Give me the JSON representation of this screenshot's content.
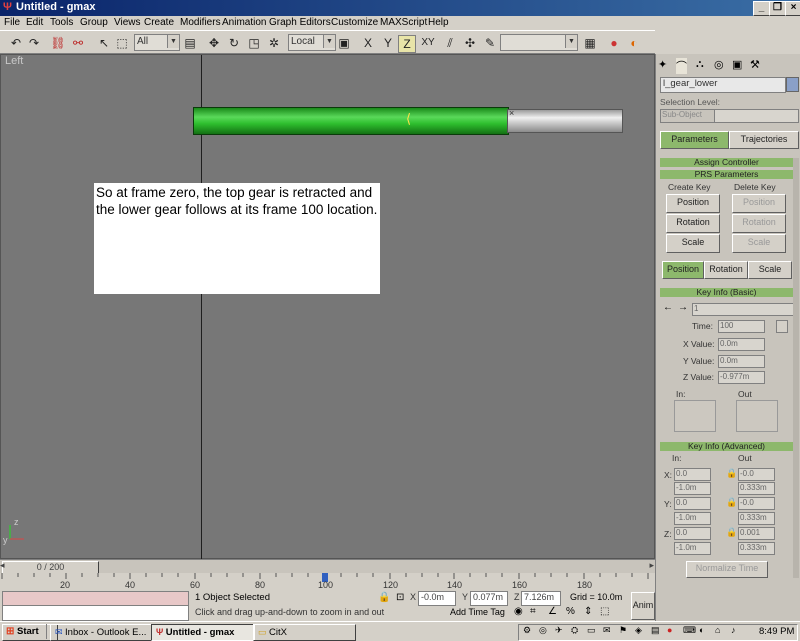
{
  "window": {
    "title": "Untitled - gmax",
    "min": "_",
    "max": "❐",
    "close": "×"
  },
  "menu": [
    "File",
    "Edit",
    "Tools",
    "Group",
    "Views",
    "Create",
    "Modifiers",
    "Animation",
    "Graph Editors",
    "Customize",
    "MAXScript",
    "Help"
  ],
  "toolbar": {
    "selection_filter": "All",
    "coord_system": "Local",
    "axis_z": "Z",
    "axis_xy": "XY",
    "axis_x": "X",
    "axis_y": "Y"
  },
  "viewport": {
    "label": "Left",
    "note": "So at frame zero, the top gear is retracted and the lower gear follows at its frame 100 location.",
    "axis_y": "y",
    "axis_z": "z"
  },
  "timeline": {
    "slider": "0 / 200",
    "ticks": [
      "20",
      "40",
      "60",
      "80",
      "100",
      "120",
      "140",
      "160",
      "180"
    ]
  },
  "status": {
    "selection": "1 Object Selected",
    "prompt": "Click and drag up-and-down to zoom in and out",
    "x_label": "X",
    "x_value": "-0.0m",
    "y_label": "Y",
    "y_value": "0.077m",
    "z_label": "Z",
    "z_value": "7.126m",
    "grid": "Grid = 10.0m",
    "add_time_tag": "Add Time Tag"
  },
  "playback": {
    "anim": "Anim",
    "frame": "0"
  },
  "panel": {
    "object_name": "l_gear_lower",
    "selection_level": "Selection Level:",
    "sub_object": "Sub-Object",
    "tab_parameters": "Parameters",
    "tab_trajectories": "Trajectories",
    "assign_controller": "Assign Controller",
    "prs_parameters": "PRS Parameters",
    "create_key": "Create Key",
    "delete_key": "Delete Key",
    "position": "Position",
    "rotation": "Rotation",
    "scale": "Scale",
    "key_info_basic": "Key Info (Basic)",
    "key_number": "1",
    "time_label": "Time:",
    "time_value": "100",
    "xvalue_label": "X Value:",
    "xvalue": "0.0m",
    "yvalue_label": "Y Value:",
    "yvalue": "0.0m",
    "zvalue_label": "Z Value:",
    "zvalue": "-0.977m",
    "in_label": "In:",
    "out_label": "Out",
    "key_info_adv": "Key Info (Advanced)",
    "adv_x": "X:",
    "adv_y": "Y:",
    "adv_z": "Z:",
    "adv_x_in": "0.0",
    "adv_x_in2": "-1.0m",
    "adv_x_out": "-0.0",
    "adv_x_out2": "0.333m",
    "adv_y_in": "0.0",
    "adv_y_in2": "-1.0m",
    "adv_y_out": "-0.0",
    "adv_y_out2": "0.333m",
    "adv_z_in": "0.0",
    "adv_z_in2": "-1.0m",
    "adv_z_out": "0.001",
    "adv_z_out2": "0.333m",
    "normalize_time": "Normalize Time"
  },
  "taskbar": {
    "start": "Start",
    "tasks": [
      "Inbox - Outlook E...",
      "Untitled - gmax",
      "CitX"
    ],
    "clock": "8:49 PM"
  },
  "colors": {
    "title": "#0a246a",
    "viewport": "#777777",
    "rollout": "#8db86c",
    "gear": "#2ebf2e"
  }
}
